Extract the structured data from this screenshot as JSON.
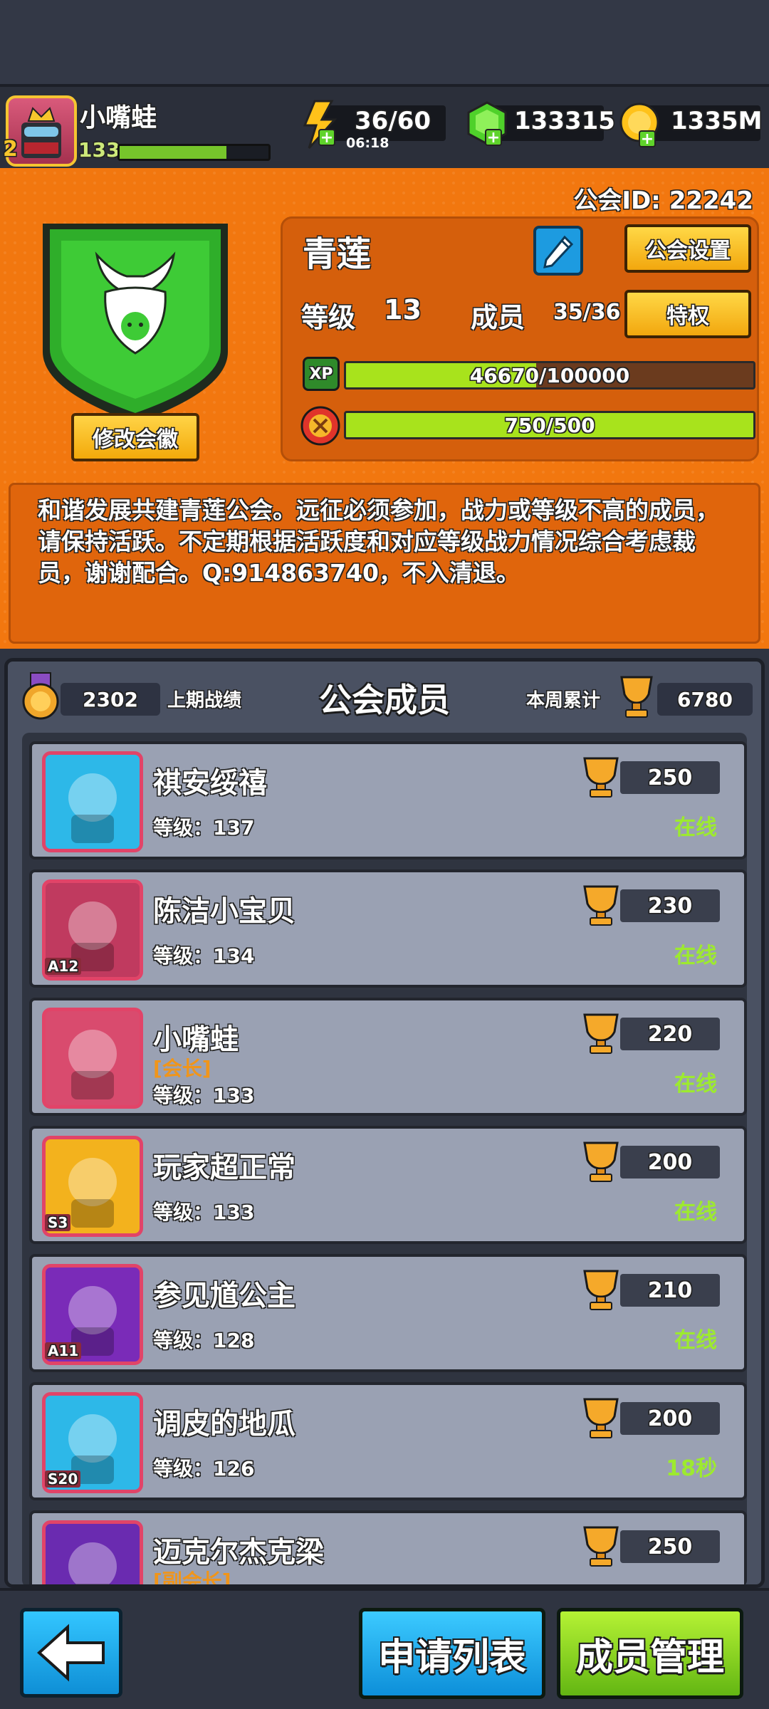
{
  "player": {
    "name": "小嘴蛙",
    "level": "133",
    "star_level": "2",
    "xp_progress": 0.72
  },
  "resources": {
    "energy": "36/60",
    "energy_timer": "06:18",
    "gems": "133315",
    "coins": "1335M"
  },
  "guild": {
    "id_text": "公会ID: 22242",
    "name": "青莲",
    "settings_label": "公会设置",
    "level_label": "等级",
    "level_value": "13",
    "members_label": "成员",
    "members_value": "35/36",
    "privilege_label": "特权",
    "xp_text": "46670/100000",
    "xp_progress": 0.4667,
    "xp_badge": "XP",
    "activity_text": "750/500",
    "activity_progress": 1.0,
    "change_emblem_label": "修改会徽",
    "description": "和谐发展共建青莲公会。远征必须参加，战力或等级不高的成员，请保持活跃。不定期根据活跃度和对应等级战力情况综合考虑裁员，谢谢配合。Q:914863740，不入清退。"
  },
  "members_panel": {
    "title": "公会成员",
    "last_score": "2302",
    "last_label": "上期战绩",
    "week_label": "本周累计",
    "week_score": "6780"
  },
  "members": [
    {
      "name": "祺安绥禧",
      "role": "",
      "level": "等级：137",
      "score": "250",
      "status": "在线",
      "avatar_color": "#2db8e8",
      "badge": ""
    },
    {
      "name": "陈洁小宝贝",
      "role": "",
      "level": "等级：134",
      "score": "230",
      "status": "在线",
      "avatar_color": "#c03a5f",
      "badge": "A12"
    },
    {
      "name": "小嘴蛙",
      "role": "[会长]",
      "level": "等级：133",
      "score": "220",
      "status": "在线",
      "avatar_color": "#d94b6e",
      "badge": ""
    },
    {
      "name": "玩家超正常",
      "role": "",
      "level": "等级：133",
      "score": "200",
      "status": "在线",
      "avatar_color": "#f3b21d",
      "badge": "S3"
    },
    {
      "name": "参见馗公主",
      "role": "",
      "level": "等级：128",
      "score": "210",
      "status": "在线",
      "avatar_color": "#7a2bb8",
      "badge": "A11"
    },
    {
      "name": "调皮的地瓜",
      "role": "",
      "level": "等级：126",
      "score": "200",
      "status": "18秒",
      "avatar_color": "#2db8e8",
      "badge": "S20"
    },
    {
      "name": "迈克尔杰克梁",
      "role": "[副会长]",
      "level": "",
      "score": "250",
      "status": "",
      "avatar_color": "#6a2bb0",
      "badge": ""
    }
  ],
  "bottom": {
    "apply_list_label": "申请列表",
    "member_manage_label": "成员管理"
  },
  "colors": {
    "orange": "#f2770f",
    "green": "#a8e31c",
    "blue": "#1d9be0",
    "online": "#9dea2f"
  }
}
